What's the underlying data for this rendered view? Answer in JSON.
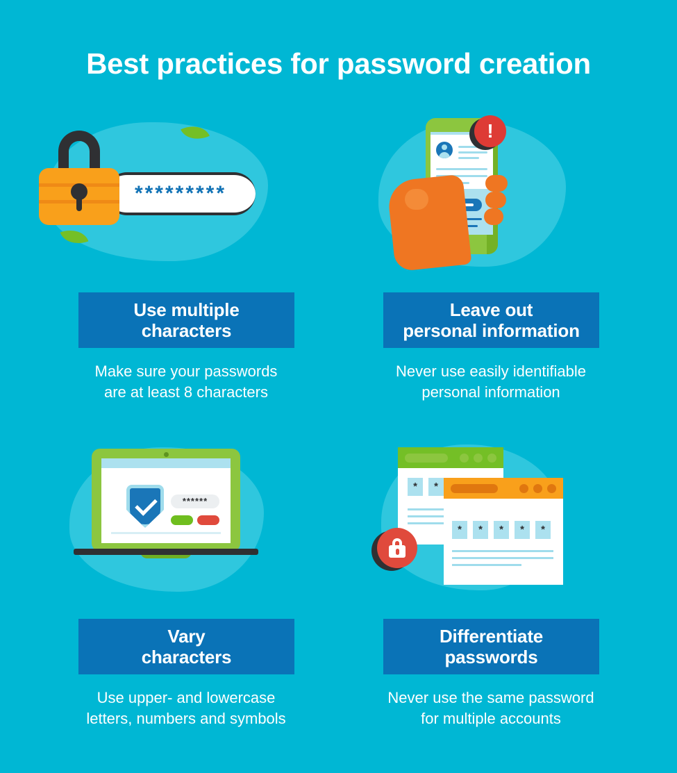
{
  "colors": {
    "background": "#00b7d4",
    "banner_blue": "#0a73b7",
    "text_white": "#ffffff",
    "accent_orange": "#f9a01b",
    "accent_green": "#8cc63f",
    "accent_red": "#e04a3c",
    "blob_light_blue": "#4cd0e4"
  },
  "header": {
    "title": "Best practices for password creation"
  },
  "cards": [
    {
      "heading": "Use multiple\ncharacters",
      "caption": "Make sure your passwords\nare at least 8 characters",
      "illustration": "padlock-password-field-icon",
      "password_field_value": "*********"
    },
    {
      "heading": "Leave out\npersonal information",
      "caption": "Never use easily identifiable\npersonal information",
      "illustration": "hand-holding-phone-alert-icon",
      "alert_symbol": "!"
    },
    {
      "heading": "Vary\ncharacters",
      "caption": "Use upper- and lowercase\nletters, numbers and symbols",
      "illustration": "laptop-shield-checkmark-icon",
      "password_field_value": "******"
    },
    {
      "heading": "Differentiate\npasswords",
      "caption": "Never use the same password\nfor multiple accounts",
      "illustration": "browser-windows-lock-icon",
      "back_window_asterisks": [
        "*",
        "*"
      ],
      "front_window_asterisks": [
        "*",
        "*",
        "*",
        "*",
        "*"
      ]
    }
  ]
}
